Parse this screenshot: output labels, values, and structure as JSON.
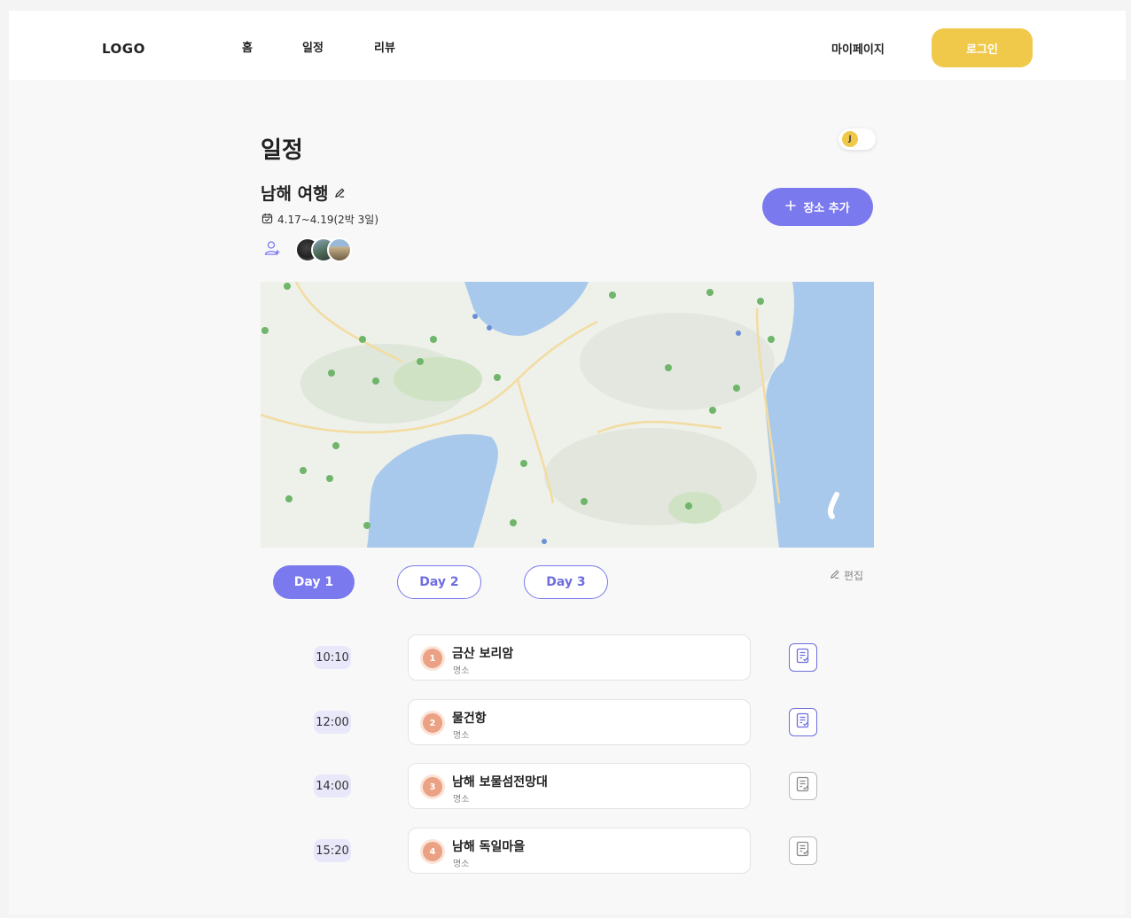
{
  "header": {
    "logo": "LOGO",
    "nav": [
      {
        "label": "홈"
      },
      {
        "label": "일정"
      },
      {
        "label": "리뷰"
      }
    ],
    "mypage": "마이페이지",
    "login": "로그인"
  },
  "page": {
    "title": "일정",
    "toggle_letter": "J"
  },
  "trip": {
    "title": "남해 여행",
    "dates": "4.17~4.19(2박 3일)",
    "add_place": "장소 추가"
  },
  "tabs": [
    {
      "label": "Day 1",
      "active": true
    },
    {
      "label": "Day 2",
      "active": false
    },
    {
      "label": "Day 3",
      "active": false
    }
  ],
  "edit_label": "편집",
  "schedule": [
    {
      "time": "10:10",
      "num": "1",
      "name": "금산 보리암",
      "category": "명소",
      "memo_active": true
    },
    {
      "time": "12:00",
      "num": "2",
      "name": "물건항",
      "category": "명소",
      "memo_active": true
    },
    {
      "time": "14:00",
      "num": "3",
      "name": "남해 보물섬전망대",
      "category": "명소",
      "memo_active": false
    },
    {
      "time": "15:20",
      "num": "4",
      "name": "남해 독일마을",
      "category": "명소",
      "memo_active": false
    }
  ],
  "colors": {
    "accent": "#7a79ee",
    "login": "#f0c94a",
    "marker": "#eaa184",
    "time_bg": "#e9e8fb",
    "map_water": "#a9c9ec",
    "map_land": "#eef0ea",
    "map_road": "#f3dca0",
    "map_park": "#cfe3c4"
  }
}
